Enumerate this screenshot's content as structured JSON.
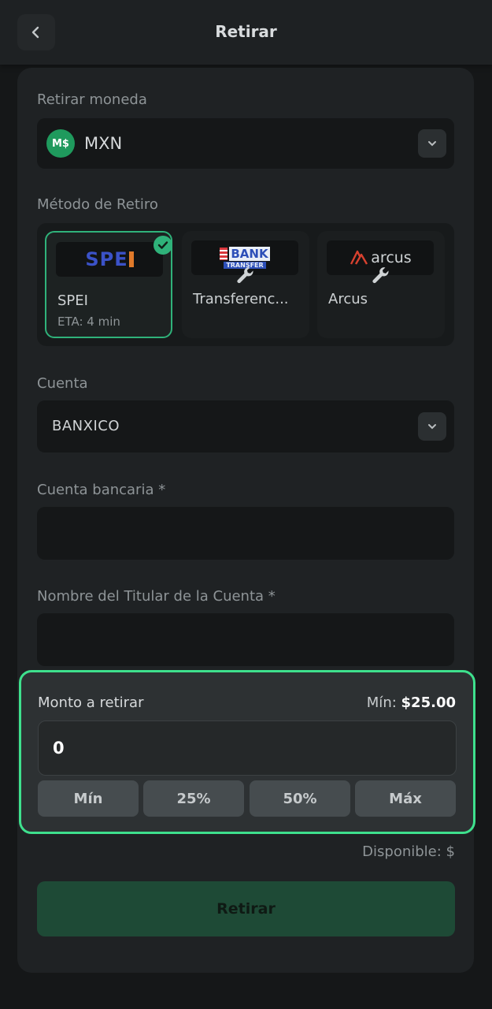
{
  "header": {
    "title": "Retirar"
  },
  "currency": {
    "label": "Retirar moneda",
    "value": "MXN",
    "icon_text": "M$"
  },
  "method": {
    "label": "Método de Retiro",
    "options": [
      {
        "name": "SPEI",
        "eta": "ETA: 4 min",
        "logo": "SPEI",
        "selected": true
      },
      {
        "name": "Transferenc...",
        "logo_top": "BANK",
        "logo_bottom": "TRANSFER",
        "maintenance": true
      },
      {
        "name": "Arcus",
        "logo": "arcus",
        "maintenance": true
      }
    ]
  },
  "account": {
    "label": "Cuenta",
    "value": "BANXICO"
  },
  "bank_account": {
    "label": "Cuenta bancaria *",
    "value": ""
  },
  "holder_name": {
    "label": "Nombre del Titular de la Cuenta *",
    "value": ""
  },
  "amount": {
    "label": "Monto a retirar",
    "min_label": "Mín:",
    "min_value": "$25.00",
    "value": "0",
    "quick_buttons": [
      "Mín",
      "25%",
      "50%",
      "Máx"
    ]
  },
  "available": "Disponible: $",
  "submit_label": "Retirar",
  "colors": {
    "accent": "#3ee08d",
    "selected_border": "#2fb27a",
    "submit_bg": "#1e4a36",
    "bg": "#151718"
  }
}
